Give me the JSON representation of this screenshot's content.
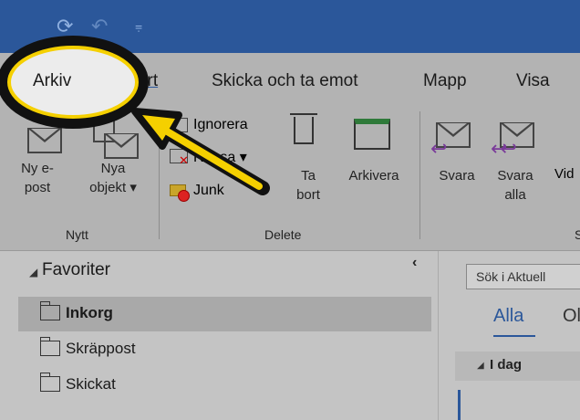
{
  "titlebar": {
    "sync_icon": "sync-icon",
    "undo_icon": "undo-icon",
    "customize_icon": "quick-access-dropdown-icon"
  },
  "tabs": [
    {
      "label": "Arkiv"
    },
    {
      "label": "Start"
    },
    {
      "label": "Skicka och ta emot"
    },
    {
      "label": "Mapp"
    },
    {
      "label": "Visa"
    }
  ],
  "ribbon": {
    "new_email": {
      "line1": "Ny e-",
      "line2": "post"
    },
    "new_items": {
      "line1": "Nya",
      "line2": "objekt ▾"
    },
    "group_new": "Nytt",
    "ignore": "Ignorera",
    "cleanup": "Rensa ▾",
    "junk": "Junk",
    "delete": {
      "line1": "Ta",
      "line2": "bort"
    },
    "archive": "Arkivera",
    "group_delete": "Delete",
    "reply": "Svara",
    "reply_all": {
      "line1": "Svara",
      "line2": "alla"
    },
    "forward_partial": "Vid",
    "group_respond_partial": "S"
  },
  "folderpane": {
    "collapse_icon": "chevron-left-icon",
    "favorites_label": "Favoriter",
    "folders": [
      {
        "label": "Inkorg",
        "selected": true
      },
      {
        "label": "Skräppost",
        "selected": false
      },
      {
        "label": "Skickat",
        "selected": false
      }
    ]
  },
  "mainpane": {
    "search_placeholder": "Sök i Aktuell",
    "filter_all": "Alla",
    "filter_unread_partial": "Ol",
    "group_today": "I dag"
  },
  "colors": {
    "titlebar": "#2b579a",
    "accent": "#2b579a",
    "annotation": "#f5d000"
  }
}
